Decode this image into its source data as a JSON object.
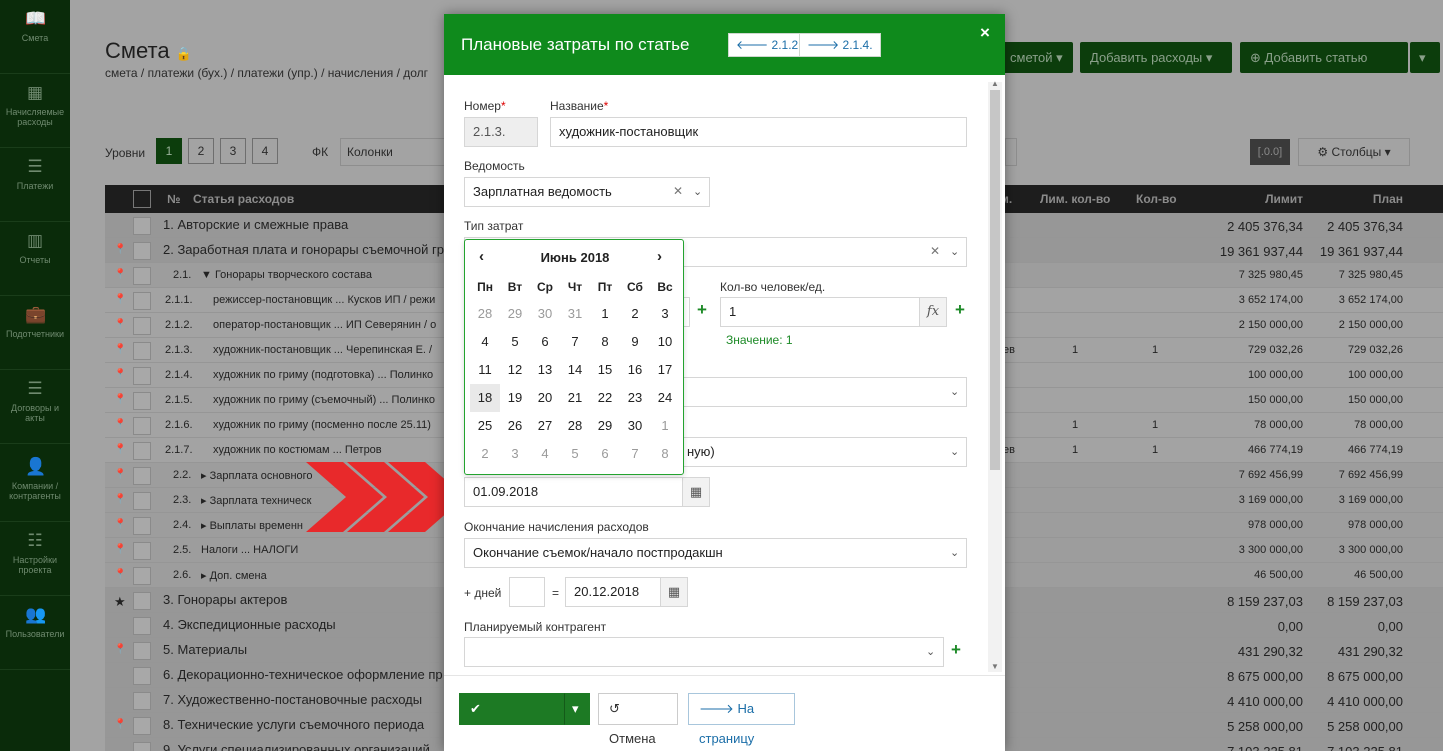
{
  "sidebar": {
    "items": [
      {
        "label": "Смета",
        "icon": "book-icon"
      },
      {
        "label": "Начисляемые расходы",
        "icon": "calendar-icon"
      },
      {
        "label": "Платежи",
        "icon": "list-icon"
      },
      {
        "label": "Отчеты",
        "icon": "chart-icon"
      },
      {
        "label": "Подотчетники",
        "icon": "briefcase-icon"
      },
      {
        "label": "Договоры и акты",
        "icon": "list-icon"
      },
      {
        "label": "Компании / контрагенты",
        "icon": "user-icon"
      },
      {
        "label": "Настройки проекта",
        "icon": "sliders-icon"
      },
      {
        "label": "Пользователи",
        "icon": "users-icon"
      }
    ]
  },
  "page": {
    "title": "Смета",
    "breadcrumb": "смета / платежи (бух.) / платежи (упр.) / начисления / долг",
    "btn_budget": "сметой ▾",
    "btn_add_expenses": "Добавить расходы ▾",
    "btn_add_item": "Добавить статью",
    "levels_label": "Уровни",
    "levels": [
      "1",
      "2",
      "3",
      "4"
    ],
    "fk_label": "ФК",
    "columns_placeholder": "Колонки",
    "zero_badge": "[.0.0]",
    "columns_btn": "Столбцы ▾"
  },
  "table": {
    "headers": {
      "num": "№",
      "name": "Статья расходов",
      "col_m": "м.",
      "lim_qty": "Лим. кол-во",
      "qty": "Кол-во",
      "limit": "Лимит",
      "plan": "План"
    },
    "rows": [
      {
        "lvl": 1,
        "icon": "",
        "num": "",
        "name": "1. Авторские и смежные права",
        "extra": "",
        "limq": "",
        "qty": "",
        "limit": "2 405 376,34",
        "plan": "2 405 376,34"
      },
      {
        "lvl": 1,
        "icon": "pin",
        "num": "",
        "name": "2. Заработная плата и гонорары съемочной гр",
        "extra": "",
        "limq": "",
        "qty": "",
        "limit": "19 361 937,44",
        "plan": "19 361 937,44"
      },
      {
        "lvl": 2,
        "icon": "pin",
        "num": "2.1.",
        "name": "▼ Гонорары творческого состава",
        "extra": "",
        "limq": "",
        "qty": "",
        "limit": "7 325 980,45",
        "plan": "7 325 980,45"
      },
      {
        "lvl": 3,
        "icon": "pin",
        "num": "2.1.1.",
        "name": "режиссер-постановщик ... Кусков ИП / режи",
        "extra": "",
        "limq": "",
        "qty": "",
        "limit": "3 652 174,00",
        "plan": "3 652 174,00"
      },
      {
        "lvl": 3,
        "icon": "pin",
        "num": "2.1.2.",
        "name": "оператор-постановщик ... ИП Северянин / о",
        "extra": "",
        "limq": "",
        "qty": "",
        "limit": "2 150 000,00",
        "plan": "2 150 000,00"
      },
      {
        "lvl": 3,
        "icon": "pin",
        "num": "2.1.3.",
        "name": "художник-постановщик ... Черепинская Е. /",
        "extra": "ев",
        "limq": "1",
        "qty": "1",
        "limit": "729 032,26",
        "plan": "729 032,26"
      },
      {
        "lvl": 3,
        "icon": "pin",
        "num": "2.1.4.",
        "name": "художник по гриму (подготовка) ... Полинко",
        "extra": "",
        "limq": "",
        "qty": "",
        "limit": "100 000,00",
        "plan": "100 000,00"
      },
      {
        "lvl": 3,
        "icon": "pin",
        "num": "2.1.5.",
        "name": "художник по гриму (съемочный) ... Полинко",
        "extra": "",
        "limq": "",
        "qty": "",
        "limit": "150 000,00",
        "plan": "150 000,00"
      },
      {
        "lvl": 3,
        "icon": "pin",
        "num": "2.1.6.",
        "name": "художник по гриму (посменно после 25.11)",
        "extra": "",
        "limq": "1",
        "qty": "1",
        "limit": "78 000,00",
        "plan": "78 000,00"
      },
      {
        "lvl": 3,
        "icon": "pin",
        "num": "2.1.7.",
        "name": "художник по костюмам ... Петров",
        "extra": "ев",
        "limq": "1",
        "qty": "1",
        "limit": "466 774,19",
        "plan": "466 774,19"
      },
      {
        "lvl": 2,
        "icon": "pin",
        "num": "2.2.",
        "name": "▸ Зарплата основного",
        "extra": "",
        "limq": "",
        "qty": "",
        "limit": "7 692 456,99",
        "plan": "7 692 456,99"
      },
      {
        "lvl": 2,
        "icon": "pin",
        "num": "2.3.",
        "name": "▸ Зарплата техническ",
        "extra": "",
        "limq": "",
        "qty": "",
        "limit": "3 169 000,00",
        "plan": "3 169 000,00"
      },
      {
        "lvl": 2,
        "icon": "pin",
        "num": "2.4.",
        "name": "▸ Выплаты временн",
        "extra": "",
        "limq": "",
        "qty": "",
        "limit": "978 000,00",
        "plan": "978 000,00"
      },
      {
        "lvl": 2,
        "icon": "pin",
        "num": "2.5.",
        "name": "Налоги ... НАЛОГИ",
        "extra": "",
        "limq": "",
        "qty": "",
        "limit": "3 300 000,00",
        "plan": "3 300 000,00"
      },
      {
        "lvl": 2,
        "icon": "pin",
        "num": "2.6.",
        "name": "▸ Доп. смена",
        "extra": "",
        "limq": "",
        "qty": "",
        "limit": "46 500,00",
        "plan": "46 500,00"
      },
      {
        "lvl": 1,
        "icon": "star",
        "num": "",
        "name": "3. Гонорары актеров",
        "extra": "",
        "limq": "",
        "qty": "",
        "limit": "8 159 237,03",
        "plan": "8 159 237,03"
      },
      {
        "lvl": 1,
        "icon": "",
        "num": "",
        "name": "4. Экспедиционные расходы",
        "extra": "",
        "limq": "",
        "qty": "",
        "limit": "0,00",
        "plan": "0,00"
      },
      {
        "lvl": 1,
        "icon": "pin",
        "num": "",
        "name": "5. Материалы",
        "extra": "",
        "limq": "",
        "qty": "",
        "limit": "431 290,32",
        "plan": "431 290,32"
      },
      {
        "lvl": 1,
        "icon": "",
        "num": "",
        "name": "6. Декорационно-техническое оформление пр",
        "extra": "",
        "limq": "",
        "qty": "",
        "limit": "8 675 000,00",
        "plan": "8 675 000,00"
      },
      {
        "lvl": 1,
        "icon": "",
        "num": "",
        "name": "7. Художественно-постановочные расходы",
        "extra": "",
        "limq": "",
        "qty": "",
        "limit": "4 410 000,00",
        "plan": "4 410 000,00"
      },
      {
        "lvl": 1,
        "icon": "pin",
        "num": "",
        "name": "8. Технические услуги съемочного периода",
        "extra": "",
        "limq": "",
        "qty": "",
        "limit": "5 258 000,00",
        "plan": "5 258 000,00"
      },
      {
        "lvl": 1,
        "icon": "",
        "num": "",
        "name": "9. Услуги специализированных организаций",
        "extra": "",
        "limq": "",
        "qty": "",
        "limit": "7 103 225,81",
        "plan": "7 103 225,81"
      }
    ]
  },
  "modal": {
    "title": "Плановые затраты по статье",
    "prev_label": "2.1.2.",
    "next_label": "2.1.4.",
    "close": "×",
    "number_label": "Номер",
    "number_value": "2.1.3.",
    "name_label": "Название",
    "name_value": "художник-постановщик",
    "sheet_label": "Ведомость",
    "sheet_value": "Зарплатная ведомость",
    "cost_type_label": "Тип затрат",
    "people_label": "Кол-во человек/ед.",
    "people_value": "1",
    "fx": "fx",
    "value_hint": "Значение: 1",
    "partial_select_text": "ную)",
    "start_date_value": "01.09.2018",
    "end_label": "Окончание начисления расходов",
    "end_value": "Окончание съемок/начало постпродакшн",
    "days_label": "+ дней",
    "days_value": "",
    "eq": "=",
    "end_date_value": "20.12.2018",
    "contractor_label": "Планируемый контрагент",
    "contractor_value": "",
    "req_mark": "*"
  },
  "datepicker": {
    "month": "Июнь 2018",
    "weekdays": [
      "Пн",
      "Вт",
      "Ср",
      "Чт",
      "Пт",
      "Сб",
      "Вс"
    ],
    "weeks": [
      [
        "28",
        "29",
        "30",
        "31",
        "1",
        "2",
        "3"
      ],
      [
        "4",
        "5",
        "6",
        "7",
        "8",
        "9",
        "10"
      ],
      [
        "11",
        "12",
        "13",
        "14",
        "15",
        "16",
        "17"
      ],
      [
        "18",
        "19",
        "20",
        "21",
        "22",
        "23",
        "24"
      ],
      [
        "25",
        "26",
        "27",
        "28",
        "29",
        "30",
        "1"
      ],
      [
        "2",
        "3",
        "4",
        "5",
        "6",
        "7",
        "8"
      ]
    ],
    "selected": "18"
  },
  "footer": {
    "save": "Сохранить",
    "cancel": "Отмена",
    "to_page": "На страницу"
  },
  "colors": {
    "header_green": "#0f8a1c",
    "save_green": "#1d7a24",
    "arrow_red": "#e8292b",
    "link_blue": "#1b6ea8"
  }
}
